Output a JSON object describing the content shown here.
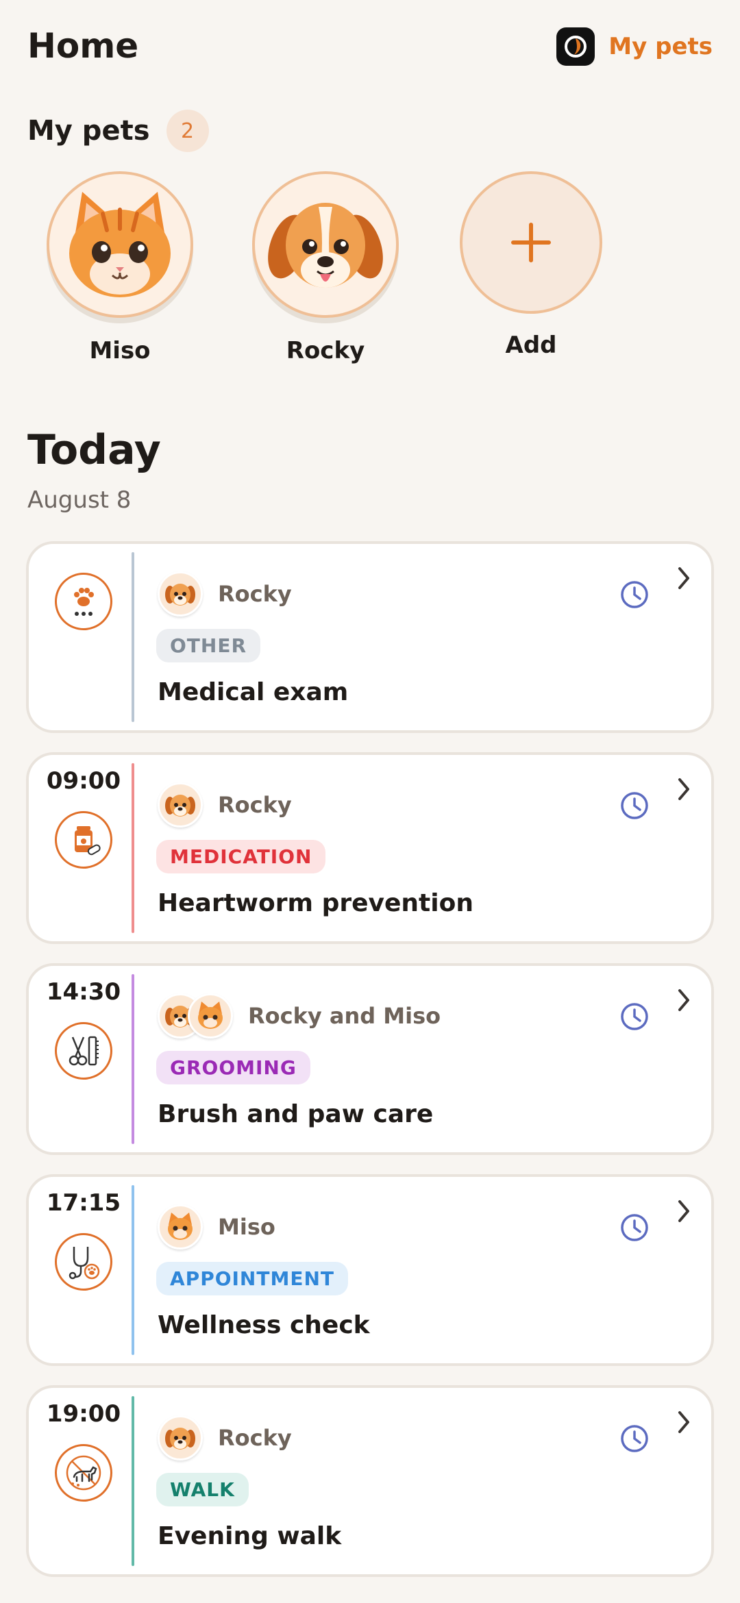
{
  "header": {
    "title": "Home",
    "my_pets_link": "My pets"
  },
  "pets_section": {
    "heading": "My pets",
    "count": "2",
    "pets": [
      {
        "name": "Miso",
        "icon": "cat-avatar"
      },
      {
        "name": "Rocky",
        "icon": "dog-avatar"
      }
    ],
    "add_label": "Add"
  },
  "today": {
    "title": "Today",
    "date": "August 8"
  },
  "tasks": [
    {
      "time": "",
      "pet": "Rocky",
      "category": "OTHER",
      "title": "Medical exam",
      "icon": "paw-more-icon",
      "accent": "#b9c6d3",
      "badge_bg": "#eceef1",
      "badge_fg": "#7f8a95"
    },
    {
      "time": "09:00",
      "pet": "Rocky",
      "category": "MEDICATION",
      "title": "Heartworm prevention",
      "icon": "medicine-bottle-icon",
      "accent": "#ef8e8e",
      "badge_bg": "#fde3e3",
      "badge_fg": "#e0323a"
    },
    {
      "time": "14:30",
      "pet": "Rocky and Miso",
      "category": "GROOMING",
      "title": "Brush and paw care",
      "icon": "grooming-scissors-comb-icon",
      "accent": "#c48be0",
      "badge_bg": "#f2e1f6",
      "badge_fg": "#9a2ab5"
    },
    {
      "time": "17:15",
      "pet": "Miso",
      "category": "APPOINTMENT",
      "title": "Wellness check",
      "icon": "stethoscope-icon",
      "accent": "#8fc2ee",
      "badge_bg": "#e3f0fb",
      "badge_fg": "#2f86d8"
    },
    {
      "time": "19:00",
      "pet": "Rocky",
      "category": "WALK",
      "title": "Evening walk",
      "icon": "dog-walk-icon",
      "accent": "#62b9a8",
      "badge_bg": "#e0f2ee",
      "badge_fg": "#14806c"
    }
  ],
  "colors": {
    "brand": "#e07520",
    "background": "#f8f5f1",
    "clock": "#5c6bc0"
  }
}
